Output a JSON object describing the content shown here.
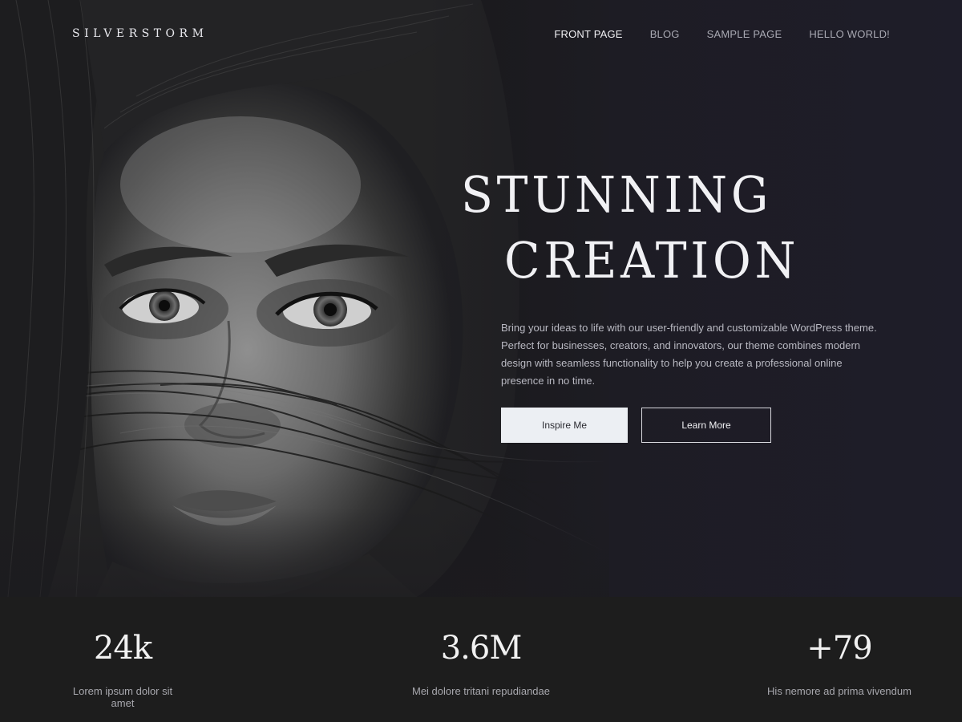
{
  "site": {
    "title": "SILVERSTORM"
  },
  "nav": {
    "items": [
      {
        "label": "FRONT PAGE",
        "active": true
      },
      {
        "label": "BLOG",
        "active": false
      },
      {
        "label": "SAMPLE PAGE",
        "active": false
      },
      {
        "label": "HELLO WORLD!",
        "active": false
      }
    ]
  },
  "hero": {
    "title_line1": "STUNNING",
    "title_line2": "CREATION",
    "description": "Bring your ideas to life with our user-friendly and customizable WordPress theme. Perfect for businesses, creators, and innovators, our theme combines modern design with seamless functionality to help you create a professional online presence in no time.",
    "primary_button": "Inspire Me",
    "secondary_button": "Learn More",
    "image": "black-and-white-portrait-woman"
  },
  "stats": [
    {
      "value": "24k",
      "label": "Lorem ipsum dolor sit amet"
    },
    {
      "value": "3.6M",
      "label": "Mei dolore tritani repudiandae"
    },
    {
      "value": "+79",
      "label": "His nemore ad prima vivendum"
    }
  ],
  "colors": {
    "hero_bg": "#1d1c23",
    "stats_bg": "#1d1d1d",
    "text_primary": "#f1f1f4",
    "text_muted": "#a9a9b3",
    "button_primary_bg": "#eceff3"
  }
}
